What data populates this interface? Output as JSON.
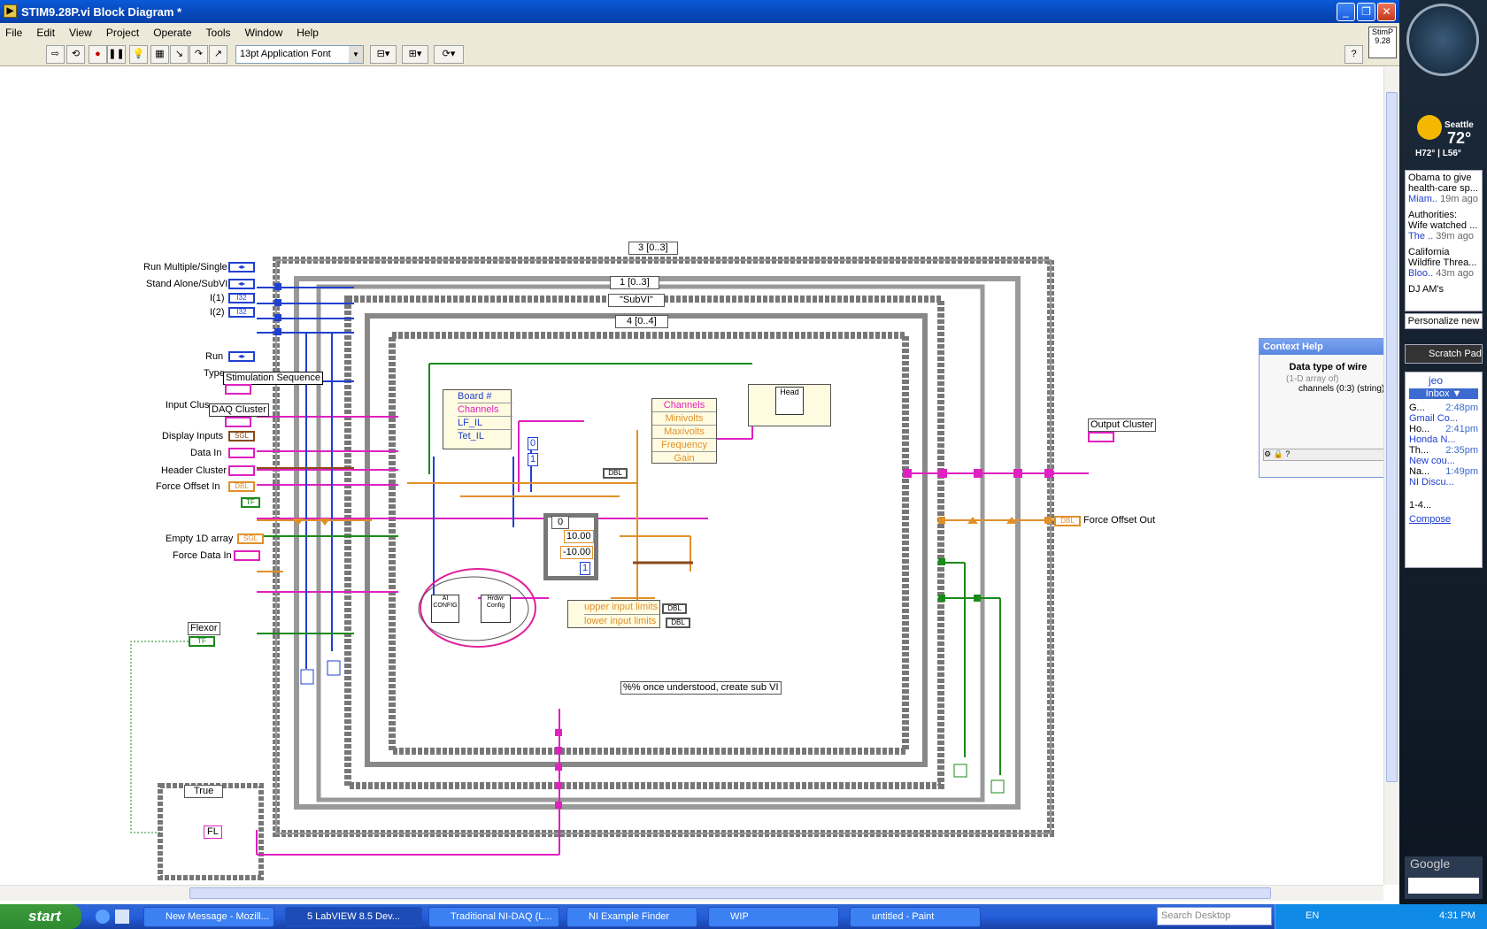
{
  "window": {
    "title": "STIM9.28P.vi Block Diagram *"
  },
  "menu": [
    "File",
    "Edit",
    "View",
    "Project",
    "Operate",
    "Tools",
    "Window",
    "Help"
  ],
  "toolbar": {
    "font": "13pt Application Font",
    "vi_icon": "StimP 9.28"
  },
  "diagram": {
    "controls": [
      {
        "label": "Run Multiple/Single",
        "type": "◂▸"
      },
      {
        "label": "Stand Alone/SubVI",
        "type": "◂▸"
      },
      {
        "label": "I(1)",
        "type": "I32"
      },
      {
        "label": "I(2)",
        "type": "I32"
      },
      {
        "label": "Run",
        "type": "◂▸"
      },
      {
        "label": "Type",
        "type": ""
      },
      {
        "label": "Stimulation Sequence",
        "type": ""
      },
      {
        "label": "Input Clus",
        "type": ""
      },
      {
        "label": "DAQ Cluster",
        "type": ""
      },
      {
        "label": "Display Inputs",
        "type": "SGL"
      },
      {
        "label": "Data In",
        "type": ""
      },
      {
        "label": "Header Cluster",
        "type": ""
      },
      {
        "label": "Force Offset In",
        "type": "DBL"
      },
      {
        "label": "Empty 1D array",
        "type": "SGL"
      },
      {
        "label": "Force Data In",
        "type": ""
      },
      {
        "label": "Flexor",
        "type": "TF"
      }
    ],
    "outputs": [
      {
        "label": "Output Cluster"
      },
      {
        "label": "Force Offset Out",
        "type": "DBL"
      }
    ],
    "selectors": {
      "outer_seq": "3 [0..3]",
      "seq2": "1 [0..3]",
      "case": "\"SubVI\"",
      "seq3": "4 [0..4]",
      "case_true": "True",
      "inner": "0"
    },
    "bundle": [
      "Board #",
      "Channels",
      "LF_IL",
      "Tet_IL"
    ],
    "unbundle": [
      "Channels",
      "Minivolts",
      "Maxivolts",
      "Frequency",
      "Gain"
    ],
    "limits": [
      "upper input limits",
      "lower input limits"
    ],
    "constants": {
      "c10": "10.00",
      "cm10": "-10.00",
      "one": "1",
      "zero": "0",
      "fl": "FL",
      "dbl": "DBL"
    },
    "subvis": {
      "ai": "AI CONFIG",
      "hw": "Hrdwr Config",
      "head": "Head"
    },
    "comment": "%% once understood, create sub VI"
  },
  "context_help": {
    "title": "Context Help",
    "heading": "Data type of wire",
    "line1": "(1-D array of)",
    "line2": "channels (0:3) (string)"
  },
  "sidebar": {
    "weather": {
      "city": "Seattle",
      "temp": "72°",
      "range": "H72° | L56°"
    },
    "news": [
      {
        "title": "Obama to give health-care sp...",
        "src": "Miam..",
        "age": "19m ago"
      },
      {
        "title": "Authorities: Wife watched ...",
        "src": "The ..",
        "age": "39m ago"
      },
      {
        "title": "California Wildfire Threa...",
        "src": "Bloo..",
        "age": "43m ago"
      },
      {
        "title": "DJ AM's",
        "src": "",
        "age": ""
      }
    ],
    "personalize": "Personalize new",
    "scratch": "Scratch Pad",
    "gmail": {
      "user": "jeo",
      "folder": "Inbox ▼",
      "paging": "1-4...",
      "compose": "Compose",
      "mails": [
        {
          "from": "G...",
          "time": "2:48pm",
          "subject": "Gmail Co..."
        },
        {
          "from": "Ho...",
          "time": "2:41pm",
          "subject": "Honda N..."
        },
        {
          "from": "Th...",
          "time": "2:35pm",
          "subject": "New cou..."
        },
        {
          "from": "Na...",
          "time": "1:49pm",
          "subject": "NI Discu..."
        }
      ]
    },
    "google": "Google"
  },
  "taskbar": {
    "start": "start",
    "tasks": [
      "New Message - Mozill...",
      "5 LabVIEW 8.5 Dev...",
      "Traditional NI-DAQ (L...",
      "NI Example Finder",
      "WIP",
      "untitled - Paint"
    ],
    "search": "Search Desktop",
    "lang": "EN",
    "clock": "4:31 PM"
  }
}
